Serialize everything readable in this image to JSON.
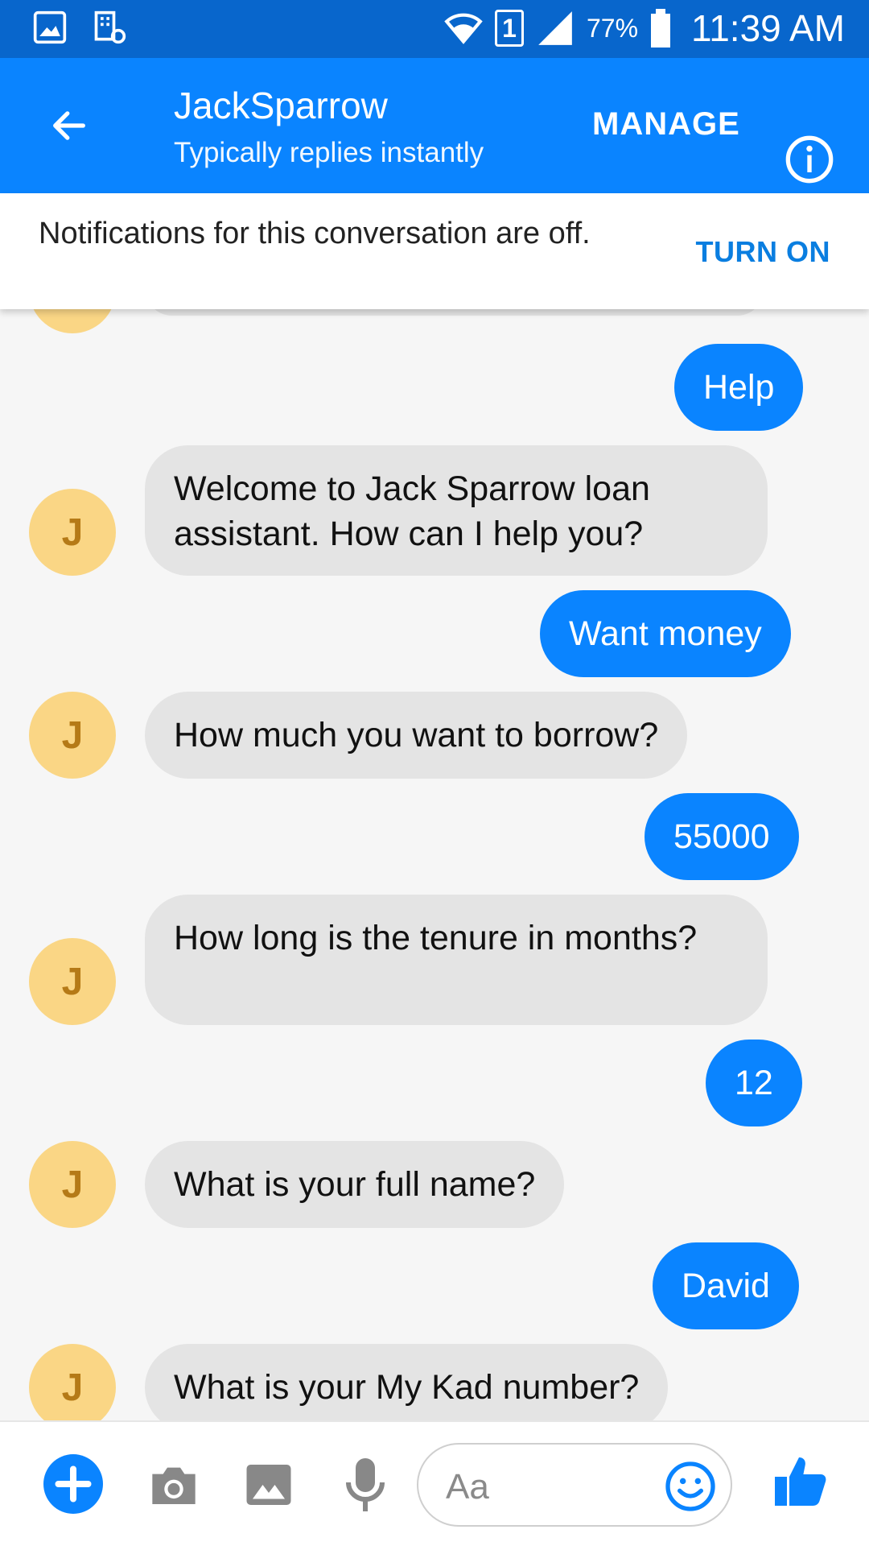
{
  "status_bar": {
    "sim_badge": "1",
    "battery": "77%",
    "time": "11:39 AM"
  },
  "header": {
    "title": "JackSparrow",
    "subtitle": "Typically replies instantly",
    "manage_label": "MANAGE"
  },
  "notification": {
    "text": "Notifications for this conversation are off.",
    "action_label": "TURN ON"
  },
  "messages": [
    {
      "sender": "user",
      "text": "Help"
    },
    {
      "sender": "bot",
      "text": "Welcome to Jack Sparrow loan assistant.  How can I help you?"
    },
    {
      "sender": "user",
      "text": "Want money"
    },
    {
      "sender": "bot",
      "text": "How much you want to borrow?"
    },
    {
      "sender": "user",
      "text": "55000"
    },
    {
      "sender": "bot",
      "text": "How long is the tenure in months?"
    },
    {
      "sender": "user",
      "text": "12"
    },
    {
      "sender": "bot",
      "text": "What is your full name?"
    },
    {
      "sender": "user",
      "text": "David"
    },
    {
      "sender": "bot",
      "text": "What is your My Kad number?"
    }
  ],
  "bot_avatar_letter": "J",
  "composer": {
    "placeholder": "Aa"
  },
  "colors": {
    "status_bar": "#0866cc",
    "app_bar": "#0a84ff",
    "outgoing_bubble": "#0a84ff",
    "incoming_bubble": "#e4e4e4",
    "avatar": "#fad685",
    "avatar_letter": "#b57a17",
    "turn_on": "#0a7ee0"
  }
}
